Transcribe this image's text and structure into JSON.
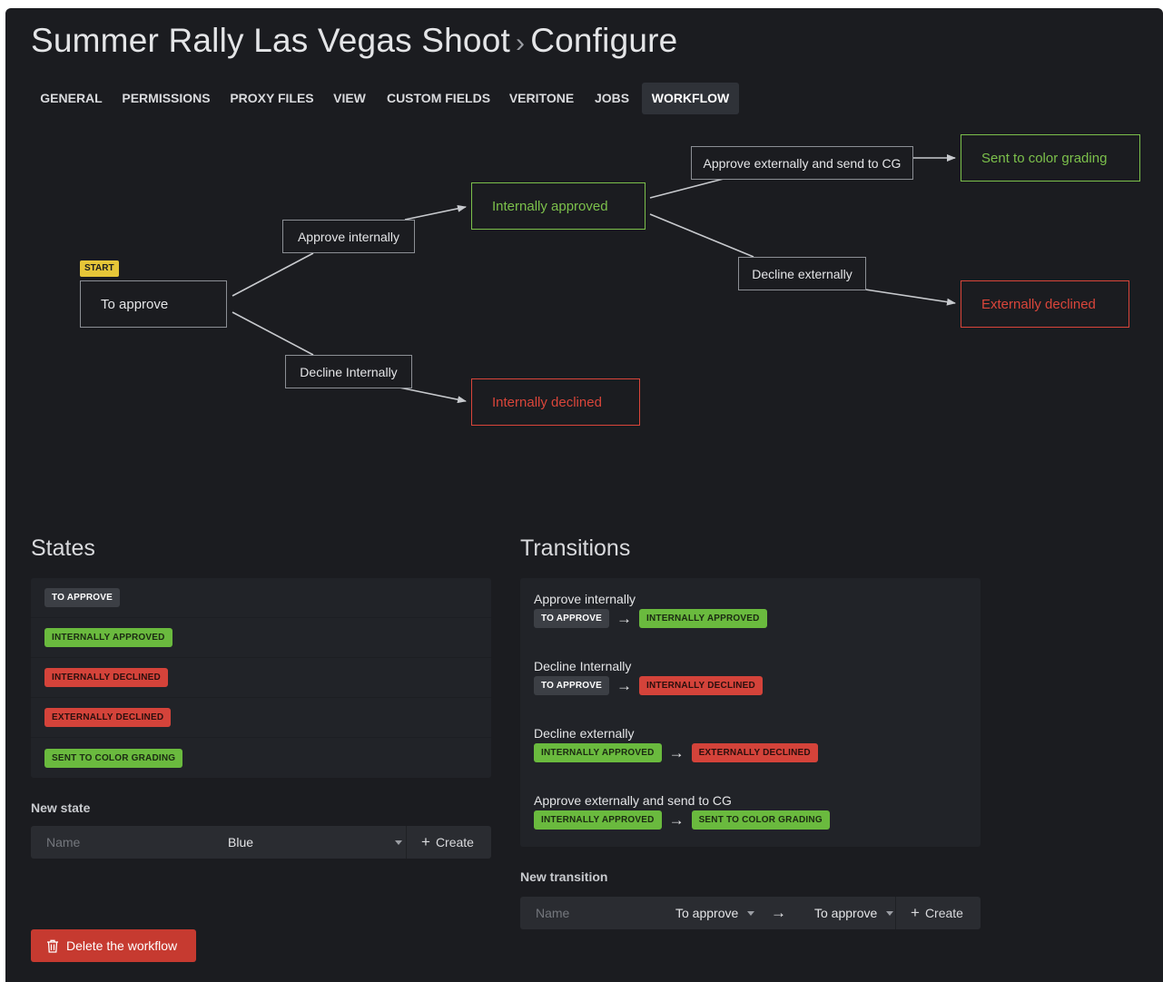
{
  "header": {
    "project": "Summer Rally Las Vegas Shoot",
    "separator": "›",
    "page": "Configure"
  },
  "tabs": [
    {
      "label": "GENERAL"
    },
    {
      "label": "PERMISSIONS"
    },
    {
      "label": "PROXY FILES"
    },
    {
      "label": "VIEW"
    },
    {
      "label": "CUSTOM FIELDS"
    },
    {
      "label": "VERITONE"
    },
    {
      "label": "JOBS"
    },
    {
      "label": "WORKFLOW",
      "active": true
    }
  ],
  "graph": {
    "start_badge": "START",
    "states": {
      "to_approve": "To approve",
      "internally_approved": "Internally approved",
      "internally_declined": "Internally declined",
      "sent_to_cg": "Sent to color grading",
      "externally_declined": "Externally declined"
    },
    "transitions": {
      "approve_internally": "Approve internally",
      "decline_internally": "Decline Internally",
      "approve_externally": "Approve externally and send to CG",
      "decline_externally": "Decline externally"
    }
  },
  "states_section": {
    "title": "States",
    "items": [
      {
        "label": "TO APPROVE",
        "color": "gray"
      },
      {
        "label": "INTERNALLY APPROVED",
        "color": "green"
      },
      {
        "label": "INTERNALLY DECLINED",
        "color": "red"
      },
      {
        "label": "EXTERNALLY DECLINED",
        "color": "red"
      },
      {
        "label": "SENT TO COLOR GRADING",
        "color": "green"
      }
    ],
    "new_state_label": "New state",
    "name_placeholder": "Name",
    "color_value": "Blue",
    "create_label": "Create"
  },
  "transitions_section": {
    "title": "Transitions",
    "items": [
      {
        "name": "Approve internally",
        "from": "TO APPROVE",
        "from_color": "gray",
        "to": "INTERNALLY APPROVED",
        "to_color": "green"
      },
      {
        "name": "Decline Internally",
        "from": "TO APPROVE",
        "from_color": "gray",
        "to": "INTERNALLY DECLINED",
        "to_color": "red"
      },
      {
        "name": "Decline externally",
        "from": "INTERNALLY APPROVED",
        "from_color": "green",
        "to": "EXTERNALLY DECLINED",
        "to_color": "red"
      },
      {
        "name": "Approve externally and send to CG",
        "from": "INTERNALLY APPROVED",
        "from_color": "green",
        "to": "SENT TO COLOR GRADING",
        "to_color": "green"
      }
    ],
    "arrow": "→",
    "new_transition_label": "New transition",
    "name_placeholder": "Name",
    "from_value": "To approve",
    "to_value": "To approve",
    "create_label": "Create"
  },
  "delete_button": "Delete the workflow",
  "colors": {
    "background": "#1b1c20",
    "green": "#7cc04b",
    "red": "#d9453a",
    "start_yellow": "#e6c638",
    "delete_red": "#c63a30"
  }
}
